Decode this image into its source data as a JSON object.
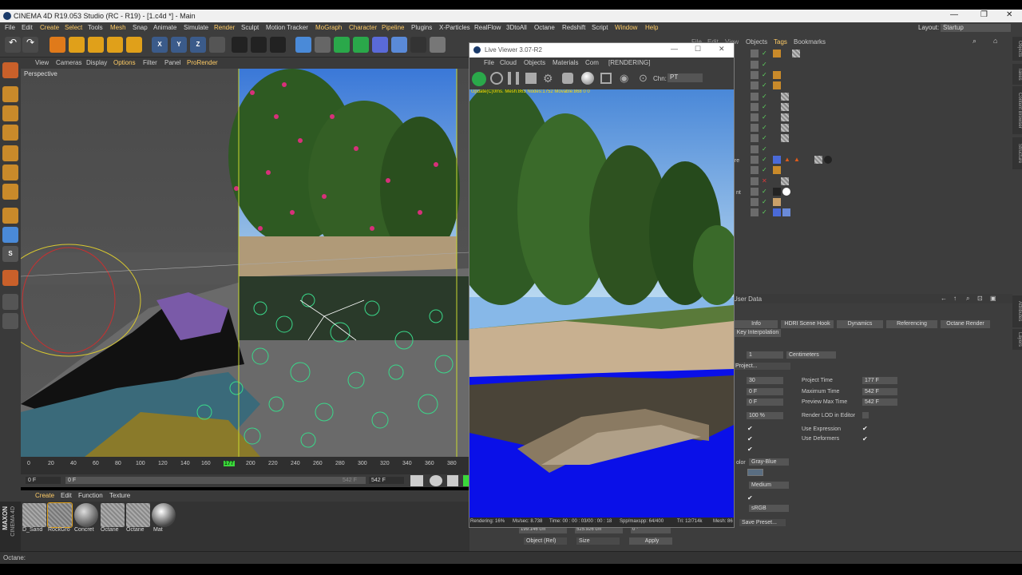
{
  "window": {
    "title": "CINEMA 4D R19.053 Studio (RC - R19) - [1.c4d *] - Main",
    "layout_label": "Layout:",
    "layout_value": "Startup"
  },
  "menu": [
    "File",
    "Edit",
    "Create",
    "Select",
    "Tools",
    "Mesh",
    "Snap",
    "Animate",
    "Simulate",
    "Render",
    "Sculpt",
    "Motion Tracker",
    "MoGraph",
    "Character",
    "Pipeline",
    "Plugins",
    "X-Particles",
    "RealFlow",
    "3DtoAll",
    "Octane",
    "Redshift",
    "Script",
    "Window",
    "Help"
  ],
  "viewport": {
    "menu": [
      "View",
      "Cameras",
      "Display",
      "Options",
      "Filter",
      "Panel",
      "ProRender"
    ],
    "label": "Perspective"
  },
  "timeline": {
    "ticks": [
      "0",
      "20",
      "40",
      "60",
      "80",
      "100",
      "120",
      "140",
      "160",
      "177",
      "200",
      "220",
      "240",
      "260",
      "280",
      "300",
      "320",
      "340",
      "360",
      "380"
    ],
    "start_field": "0 F",
    "mid_field": "0 F",
    "end_field": "542 F",
    "end_field2": "542 F"
  },
  "materials": {
    "menu": [
      "Create",
      "Edit",
      "Function",
      "Texture"
    ],
    "items": [
      "D_Sand",
      "RockGro",
      "Concret",
      "Octane",
      "Octane",
      "Mat"
    ]
  },
  "brand": {
    "maxon": "MAXON",
    "c4d": "CINEMA 4D"
  },
  "status_text": "Octane:",
  "live_viewer": {
    "title": "Live Viewer 3.07-R2",
    "menu": [
      "File",
      "Cloud",
      "Objects",
      "Materials",
      "Com",
      "[RENDERING]"
    ],
    "chn_label": "Chn:",
    "chn_value": "PT",
    "overlay_text": "Update(C)0ms. Mesh:863 Nodes:1752 Movable:868  0 0",
    "status": {
      "rendering": "Rendering: 16%",
      "ms": "Ms/sec: 8.738",
      "time": "Time: 00 : 00 : 03/00 : 00 : 18",
      "spp": "Spp/maxspp: 64/400",
      "tri": "Tri: 12/714k",
      "mesh": "Mesh: 86"
    }
  },
  "object_manager": {
    "menu": [
      "File",
      "Edit",
      "View",
      "Objects",
      "Tags",
      "Bookmarks"
    ],
    "partial_labels": [
      "oud",
      "ure",
      "nt"
    ]
  },
  "attributes": {
    "header": "User Data",
    "tabs": [
      "Info",
      "HDRI Scene Hook",
      "Dynamics",
      "Referencing",
      "Octane Render"
    ],
    "tab2": "Key Interpolation",
    "scale_value": "1",
    "units": "Centimeters",
    "project_btn": "Project...",
    "fps": "30",
    "project_time_label": "Project Time",
    "project_time": "177 F",
    "min_time": "0 F",
    "max_time_label": "Maximum Time",
    "max_time": "542 F",
    "prev_min": "0 F",
    "prev_max_label": "Preview Max Time",
    "prev_max": "542 F",
    "lod": "100 %",
    "render_lod_label": "Render LOD in Editor",
    "use_expression": "Use Expression",
    "use_deformers": "Use Deformers",
    "color_label": "olor",
    "color_value": "Gray-Blue",
    "quality": "Medium",
    "color_profile": "sRGB",
    "save_preset": "Save Preset..."
  },
  "coords": {
    "field1": "199.146 cm",
    "field2": "525.926 cm",
    "field3": "0 °",
    "mode": "Object (Rel)",
    "size": "Size",
    "apply": "Apply"
  },
  "side_tabs": [
    "Objects",
    "Takes",
    "Content Browser",
    "Structure"
  ],
  "side_tabs2": [
    "Attributes",
    "Layers"
  ]
}
